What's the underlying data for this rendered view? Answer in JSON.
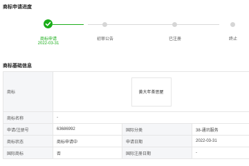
{
  "progress": {
    "title": "商标申请进度",
    "steps": [
      {
        "label": "商标申请",
        "date": "2022-03-31"
      },
      {
        "label": "初审公告"
      },
      {
        "label": "已注册"
      },
      {
        "label": "终止"
      }
    ],
    "colors": {
      "active": "#1aad19",
      "inactive": "#d6d6d6"
    }
  },
  "info": {
    "title": "商标基础信息",
    "mark_label": "商标",
    "mark_image_text": "黄大年茶思屋",
    "name_label": "商标名称",
    "name_value": "-",
    "rows": [
      {
        "l1": "申请/注册号",
        "v1": "63686992",
        "l2": "国际分类",
        "v2": "38-通讯服务"
      },
      {
        "l1": "商标状态",
        "v1": "商标申请中",
        "l2": "申请日期",
        "v2": "2022-03-31"
      },
      {
        "l1": "国际商标",
        "v1": "否",
        "l2": "国际注册日期",
        "v2": "-"
      }
    ]
  }
}
